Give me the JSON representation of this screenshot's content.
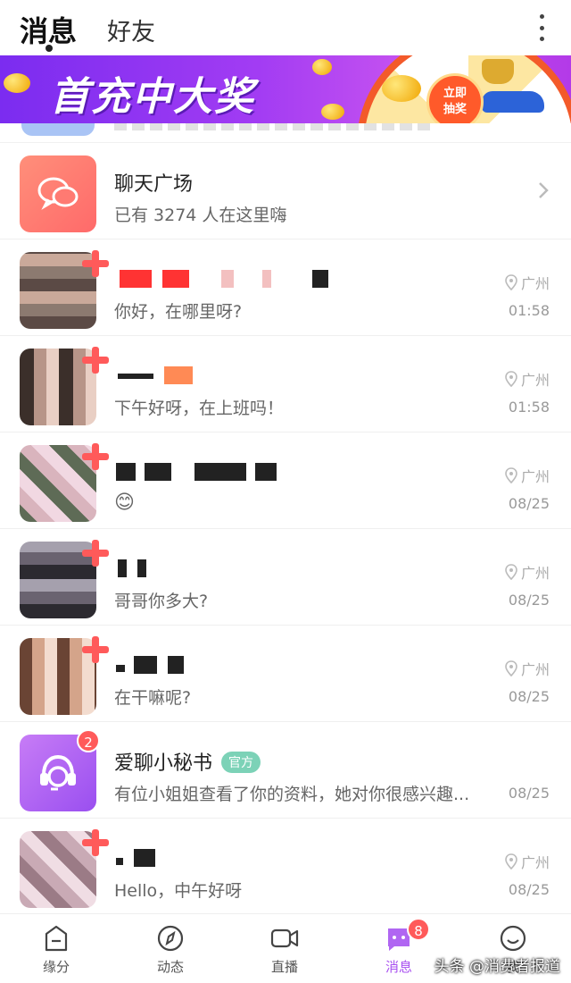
{
  "header": {
    "tabs": [
      {
        "label": "消息",
        "active": true
      },
      {
        "label": "好友",
        "active": false
      }
    ]
  },
  "banner": {
    "title": "首充中大奖",
    "button_label": "立即\n抽奖"
  },
  "chat_square": {
    "name": "聊天广场",
    "subtitle": "已有 3274 人在这里嗨"
  },
  "conversations": [
    {
      "preview": "你好，在哪里呀?",
      "location": "广州",
      "time": "01:58"
    },
    {
      "preview": "下午好呀，在上班吗！",
      "location": "广州",
      "time": "01:58"
    },
    {
      "preview": "😊",
      "location": "广州",
      "time": "08/25"
    },
    {
      "preview": "哥哥你多大?",
      "location": "广州",
      "time": "08/25"
    },
    {
      "preview": "在干嘛呢?",
      "location": "广州",
      "time": "08/25"
    }
  ],
  "secretary": {
    "name": "爱聊小秘书",
    "tag": "官方",
    "badge": "2",
    "preview": "有位小姐姐查看了你的资料，她对你很感兴趣...",
    "time": "08/25"
  },
  "last_conversation": {
    "preview": "Hello，中午好呀",
    "location": "广州",
    "time": "08/25"
  },
  "bottom_nav": {
    "items": [
      {
        "label": "缘分",
        "icon": "fate-icon"
      },
      {
        "label": "动态",
        "icon": "compass-icon"
      },
      {
        "label": "直播",
        "icon": "video-icon"
      },
      {
        "label": "消息",
        "icon": "message-icon",
        "badge": "8",
        "active": true
      },
      {
        "label": "我",
        "icon": "smile-icon"
      }
    ]
  },
  "watermark": "头条 @消费者报道",
  "colors": {
    "accent": "#a84ff0",
    "badge_red": "#ff5a5a",
    "official_tag": "#7cd2b7"
  }
}
